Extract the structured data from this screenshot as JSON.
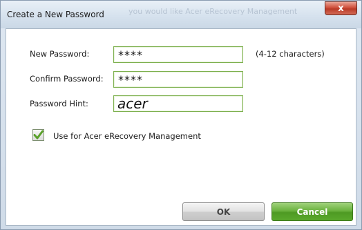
{
  "window": {
    "title": "Create a New Password",
    "title_ghost": "you would like Acer eRecovery Management",
    "close_glyph": "x"
  },
  "form": {
    "new_password_label": "New Password:",
    "new_password_value": "****",
    "length_note": "(4-12 characters)",
    "confirm_password_label": "Confirm Password:",
    "confirm_password_value": "****",
    "hint_label": "Password Hint:",
    "hint_value": "acer"
  },
  "option": {
    "label": "Use for Acer eRecovery Management",
    "checked": true
  },
  "buttons": {
    "ok_label": "OK",
    "cancel_label": "Cancel"
  },
  "colors": {
    "field_border": "#7db04e",
    "checkmark": "#5aa12a",
    "cancel_green": "#5aa82c"
  }
}
